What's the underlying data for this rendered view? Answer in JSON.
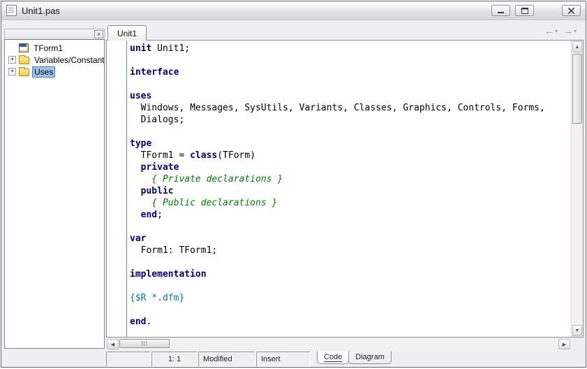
{
  "window": {
    "title": "Unit1.pas"
  },
  "icons": {
    "explorer_close": "×",
    "expand_plus": "+",
    "back_arrow": "←",
    "forward_arrow": "→",
    "dropdown": "▾",
    "scroll_up": "▲",
    "scroll_down": "▼",
    "scroll_left": "◀",
    "scroll_right": "▶"
  },
  "explorer": {
    "items": [
      {
        "label": "TForm1",
        "icon": "form-icon",
        "expander": false,
        "selected": false
      },
      {
        "label": "Variables/Constants",
        "icon": "folder-icon",
        "expander": true,
        "selected": false
      },
      {
        "label": "Uses",
        "icon": "folder-icon",
        "expander": true,
        "selected": true
      }
    ]
  },
  "editor": {
    "tab_label": "Unit1",
    "syntax_colors": {
      "keyword": "#000080",
      "plain": "#000000",
      "comment": "#008000",
      "directive": "#008080"
    },
    "code_lines": [
      [
        {
          "s": "k",
          "t": "unit"
        },
        {
          "s": "p",
          "t": " Unit1;"
        }
      ],
      [],
      [
        {
          "s": "k",
          "t": "interface"
        }
      ],
      [],
      [
        {
          "s": "k",
          "t": "uses"
        }
      ],
      [
        {
          "s": "p",
          "t": "  Windows, Messages, SysUtils, Variants, Classes, Graphics, Controls, Forms,"
        }
      ],
      [
        {
          "s": "p",
          "t": "  Dialogs;"
        }
      ],
      [],
      [
        {
          "s": "k",
          "t": "type"
        }
      ],
      [
        {
          "s": "p",
          "t": "  TForm1 = "
        },
        {
          "s": "k",
          "t": "class"
        },
        {
          "s": "p",
          "t": "(TForm)"
        }
      ],
      [
        {
          "s": "p",
          "t": "  "
        },
        {
          "s": "k",
          "t": "private"
        }
      ],
      [
        {
          "s": "c",
          "t": "    { Private declarations }"
        }
      ],
      [
        {
          "s": "p",
          "t": "  "
        },
        {
          "s": "k",
          "t": "public"
        }
      ],
      [
        {
          "s": "c",
          "t": "    { Public declarations }"
        }
      ],
      [
        {
          "s": "p",
          "t": "  "
        },
        {
          "s": "k",
          "t": "end"
        },
        {
          "s": "p",
          "t": ";"
        }
      ],
      [],
      [
        {
          "s": "k",
          "t": "var"
        }
      ],
      [
        {
          "s": "p",
          "t": "  Form1: TForm1;"
        }
      ],
      [],
      [
        {
          "s": "k",
          "t": "implementation"
        }
      ],
      [],
      [
        {
          "s": "d",
          "t": "{$R *.dfm}"
        }
      ],
      [],
      [
        {
          "s": "k",
          "t": "end"
        },
        {
          "s": "p",
          "t": "."
        }
      ]
    ]
  },
  "statusbar": {
    "position": "1: 1",
    "modified": "Modified",
    "mode": "Insert",
    "view_tabs": [
      {
        "label": "Code",
        "active": true
      },
      {
        "label": "Diagram",
        "active": false
      }
    ]
  }
}
